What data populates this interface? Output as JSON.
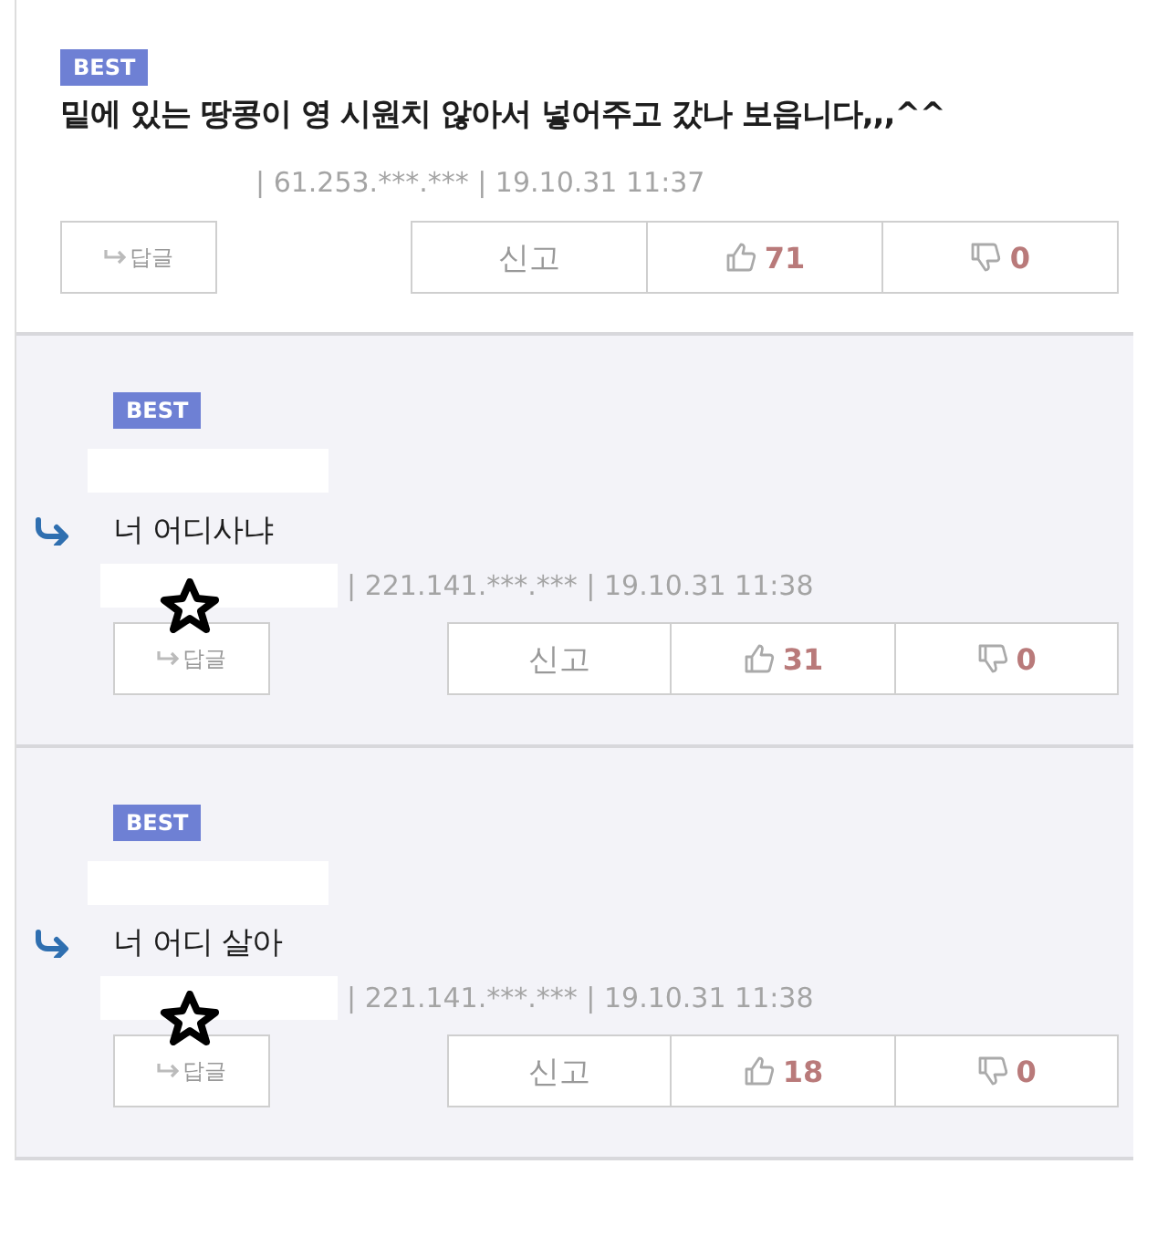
{
  "comments": [
    {
      "kind": "comment",
      "badge": "BEST",
      "text": "밑에 있는 땅콩이 영 시원치 않아서 넣어주고 갔나 보읍니다,,,^^",
      "meta": "| 61.253.***.*** | 19.10.31 11:37",
      "reply_button": "답글",
      "report_button": "신고",
      "likes": "71",
      "dislikes": "0"
    },
    {
      "kind": "reply",
      "badge": "BEST",
      "text": "너 어디사냐",
      "meta": "| 221.141.***.*** | 19.10.31 11:38",
      "reply_button": "답글",
      "report_button": "신고",
      "likes": "31",
      "dislikes": "0"
    },
    {
      "kind": "reply",
      "badge": "BEST",
      "text": "너 어디 살아",
      "meta": "| 221.141.***.*** | 19.10.31 11:38",
      "reply_button": "답글",
      "report_button": "신고",
      "likes": "18",
      "dislikes": "0"
    }
  ]
}
